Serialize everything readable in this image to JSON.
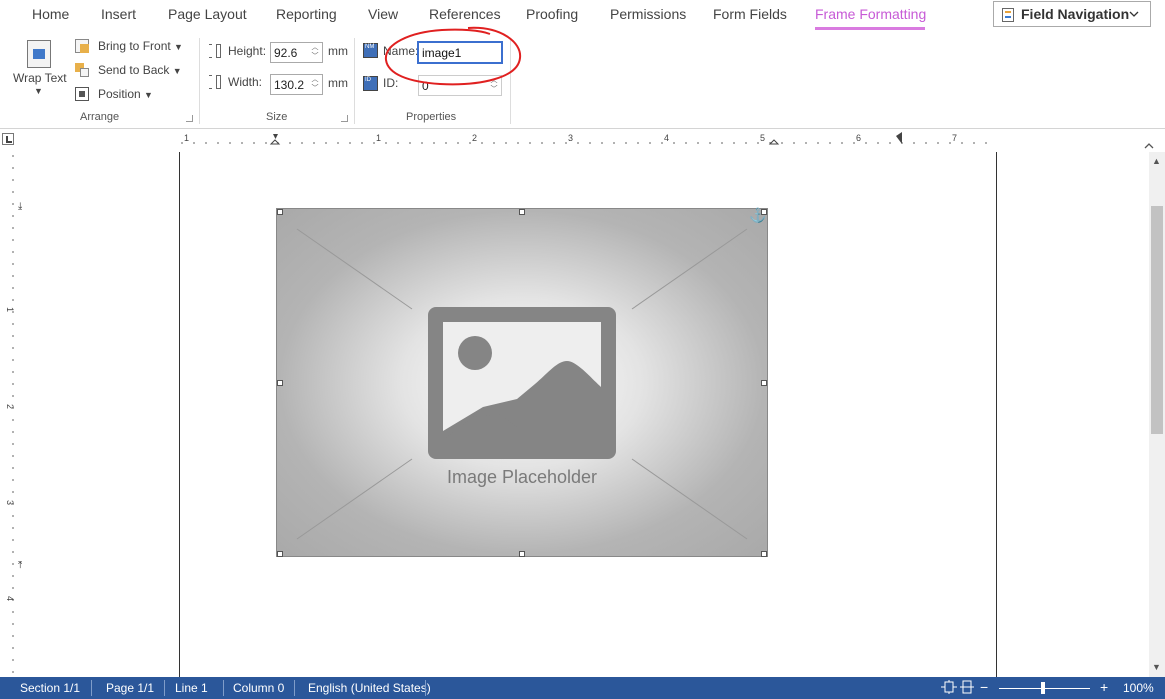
{
  "tabs": [
    {
      "label": "Home"
    },
    {
      "label": "Insert"
    },
    {
      "label": "Page Layout"
    },
    {
      "label": "Reporting"
    },
    {
      "label": "View"
    },
    {
      "label": "References"
    },
    {
      "label": "Proofing"
    },
    {
      "label": "Permissions"
    },
    {
      "label": "Form Fields"
    },
    {
      "label": "Frame Formatting"
    }
  ],
  "field_navigation": {
    "label": "Field Navigation",
    "icon": "field-navigation-icon"
  },
  "ribbon": {
    "arrange": {
      "wrap_text": "Wrap Text",
      "bring_to_front": "Bring to Front",
      "send_to_back": "Send to Back",
      "position": "Position",
      "group_label": "Arrange"
    },
    "size": {
      "height_label": "Height:",
      "height_value": "92.6",
      "width_label": "Width:",
      "width_value": "130.2",
      "unit": "mm",
      "group_label": "Size"
    },
    "properties": {
      "name_label": "Name:",
      "name_value": "image1",
      "id_label": "ID:",
      "id_value": "0",
      "group_label": "Properties"
    }
  },
  "ruler": {
    "horizontal_numbers": [
      "1",
      "1",
      "2",
      "3",
      "4",
      "5",
      "6",
      "7"
    ],
    "vertical_numbers": [
      "1",
      "2",
      "3",
      "4"
    ]
  },
  "image": {
    "placeholder_text": "Image Placeholder"
  },
  "status_bar": {
    "section": "Section 1/1",
    "page": "Page 1/1",
    "line": "Line 1",
    "column": "Column 0",
    "language": "English (United States)",
    "zoom": "100%",
    "zoom_minus": "−",
    "zoom_plus": "+"
  },
  "annotation": {
    "color": "#e02020"
  }
}
